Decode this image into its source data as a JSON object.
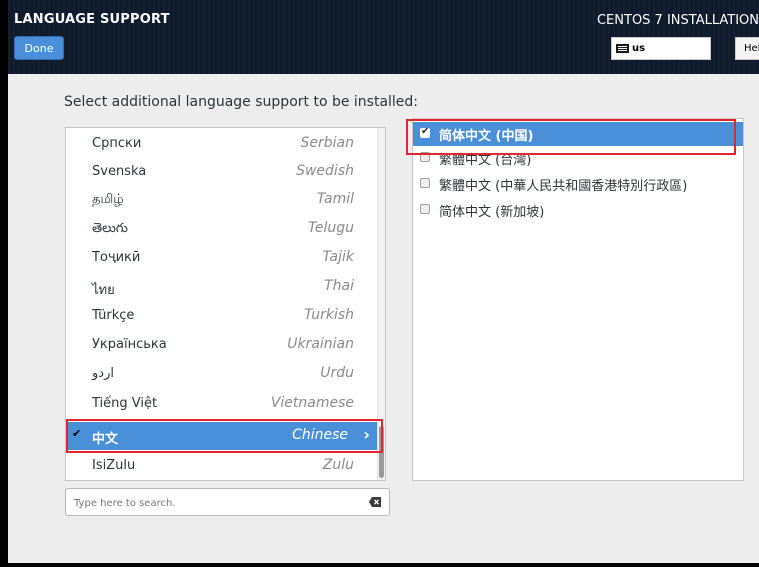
{
  "header": {
    "title": "LANGUAGE SUPPORT",
    "done_label": "Done",
    "product": "CENTOS 7 INSTALLATION",
    "keyboard_layout": "us",
    "help_label": "Help!"
  },
  "instruction": "Select additional language support to be installed:",
  "languages": [
    {
      "native": "Српски",
      "english": "Serbian"
    },
    {
      "native": "Svenska",
      "english": "Swedish"
    },
    {
      "native": "தமிழ்",
      "english": "Tamil"
    },
    {
      "native": "తెలుగు",
      "english": "Telugu"
    },
    {
      "native": "Тоҷикӣ",
      "english": "Tajik"
    },
    {
      "native": "ไทย",
      "english": "Thai"
    },
    {
      "native": "Türkçe",
      "english": "Turkish"
    },
    {
      "native": "Українська",
      "english": "Ukrainian"
    },
    {
      "native": "اردو",
      "english": "Urdu"
    },
    {
      "native": "Tiếng Việt",
      "english": "Vietnamese"
    },
    {
      "native": "中文",
      "english": "Chinese",
      "selected": true,
      "check": "✔",
      "arrow": "›"
    },
    {
      "native": "IsiZulu",
      "english": "Zulu"
    }
  ],
  "search": {
    "placeholder": "Type here to search."
  },
  "locales": [
    {
      "label": "简体中文 (中国)",
      "checked": true,
      "tick": "✔"
    },
    {
      "label": "繁體中文 (台灣)",
      "checked": false
    },
    {
      "label": "繁體中文 (中華人民共和國香港特別行政區)",
      "checked": false
    },
    {
      "label": "简体中文 (新加坡)",
      "checked": false
    }
  ],
  "colors": {
    "accent": "#4a90d9",
    "highlight_border": "#e3262f",
    "header_bg": "#0f1a2b"
  }
}
